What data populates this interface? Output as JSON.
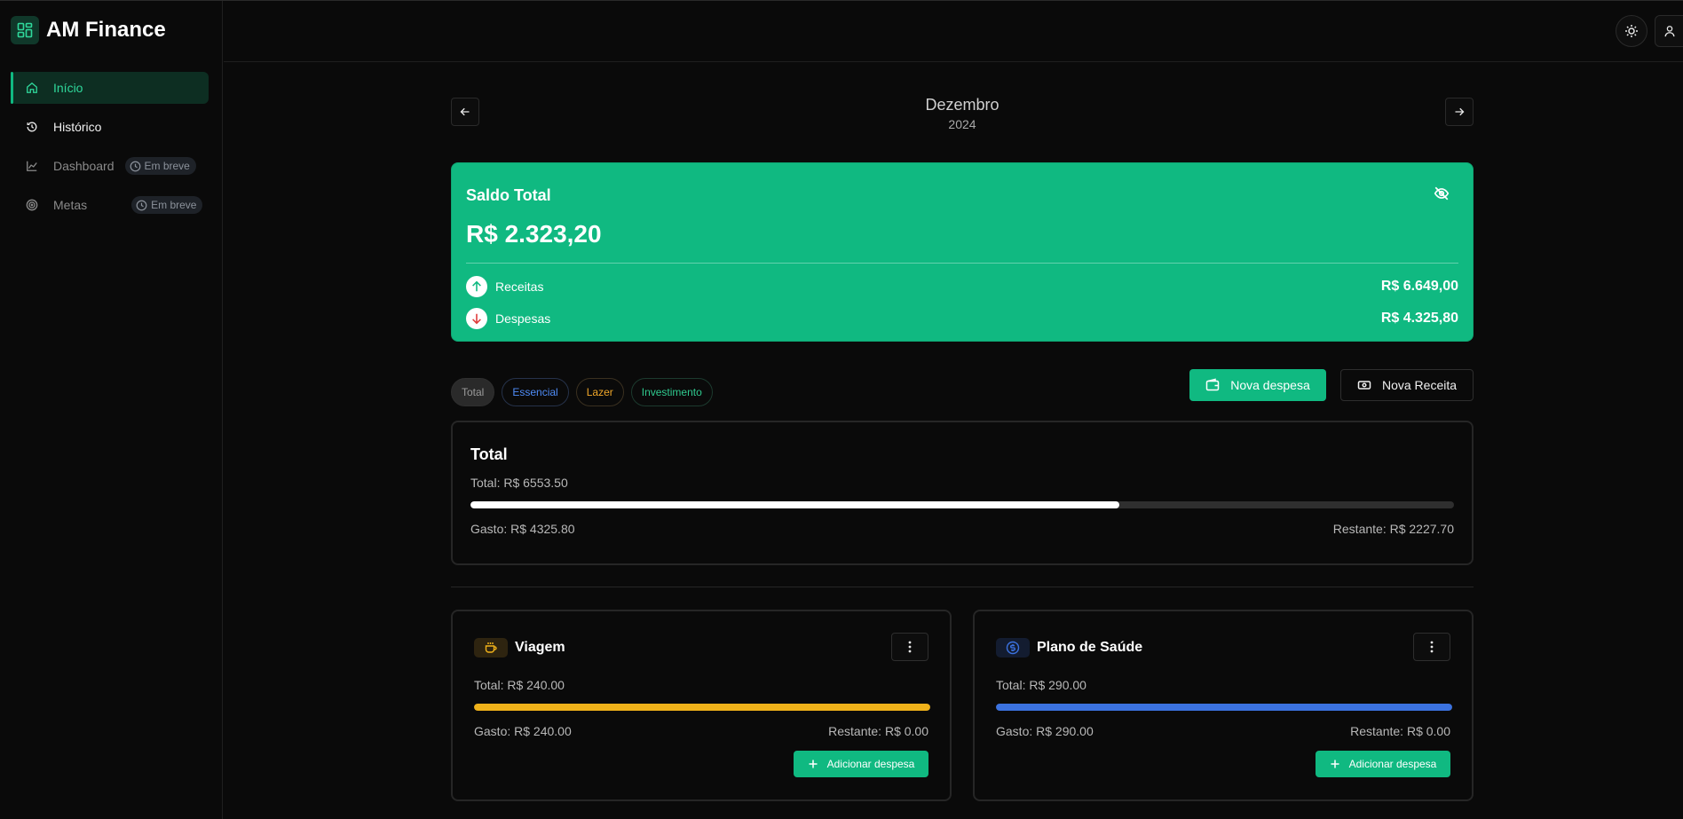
{
  "app": {
    "title": "AM Finance"
  },
  "sidebar": {
    "items": [
      {
        "label": "Início",
        "icon": "home-icon",
        "active": true
      },
      {
        "label": "Histórico",
        "icon": "history-icon"
      },
      {
        "label": "Dashboard",
        "icon": "chart-icon",
        "badge": "Em breve",
        "disabled": true
      },
      {
        "label": "Metas",
        "icon": "target-icon",
        "badge": "Em breve",
        "disabled": true
      }
    ]
  },
  "header": {
    "theme_icon": "sun-icon",
    "user_icon": "user-icon"
  },
  "period": {
    "month": "Dezembro",
    "year": "2024"
  },
  "balance": {
    "title": "Saldo Total",
    "value": "R$ 2.323,20",
    "income_label": "Receitas",
    "income_value": "R$ 6.649,00",
    "expense_label": "Despesas",
    "expense_value": "R$ 4.325,80"
  },
  "filters": [
    "Total",
    "Essencial",
    "Lazer",
    "Investimento"
  ],
  "actions": {
    "new_expense": "Nova despesa",
    "new_income": "Nova Receita"
  },
  "summary": {
    "title": "Total",
    "total": "Total: R$ 6553.50",
    "spent": "Gasto: R$ 4325.80",
    "remaining": "Restante: R$ 2227.70",
    "progress": 0.66
  },
  "categories": [
    {
      "name": "Viagem",
      "icon": "coffee-icon",
      "color": "#f0b21a",
      "total": "Total: R$ 240.00",
      "spent": "Gasto: R$ 240.00",
      "remaining": "Restante: R$ 0.00",
      "progress": 1.0,
      "add_label": "Adicionar despesa"
    },
    {
      "name": "Plano de Saúde",
      "icon": "dollar-circle-icon",
      "color": "#3b72e0",
      "total": "Total: R$ 290.00",
      "spent": "Gasto: R$ 290.00",
      "remaining": "Restante: R$ 0.00",
      "progress": 1.0,
      "add_label": "Adicionar despesa"
    }
  ],
  "colors": {
    "accent": "#10b981",
    "background": "#0a0a0a"
  }
}
